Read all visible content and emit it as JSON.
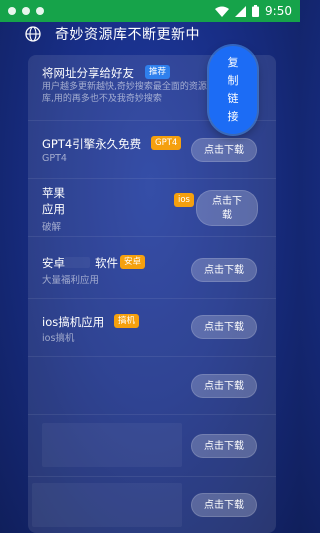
{
  "status_bar": {
    "time": "9:50"
  },
  "header": {
    "title": "奇妙资源库不断更新中"
  },
  "float_button": {
    "chars": [
      "复",
      "制",
      "链",
      "接"
    ]
  },
  "items": [
    {
      "title": "将网址分享给好友",
      "badge": "推荐",
      "subtitle": "用户越多更新越快,奇妙搜索最全面的资源库,用的再多也不及我奇妙搜索"
    },
    {
      "title": "GPT4引擎永久免费",
      "badge": "GPT4",
      "subtitle": "GPT4",
      "button": "点击下载"
    },
    {
      "title_line1": "苹果",
      "title_line2": "应用",
      "badge": "ios",
      "subtitle": "破解",
      "button_line1": "点击下",
      "button_line2": "载"
    },
    {
      "title_a": "安卓",
      "title_b": "软件",
      "badge": "安卓",
      "subtitle": "大量福利应用",
      "button": "点击下载"
    },
    {
      "title": "ios搞机应用",
      "badge": "搞机",
      "subtitle": "ios搞机",
      "button": "点击下载"
    },
    {
      "button": "点击下载"
    },
    {
      "button": "点击下载"
    },
    {
      "button": "点击下载"
    }
  ]
}
